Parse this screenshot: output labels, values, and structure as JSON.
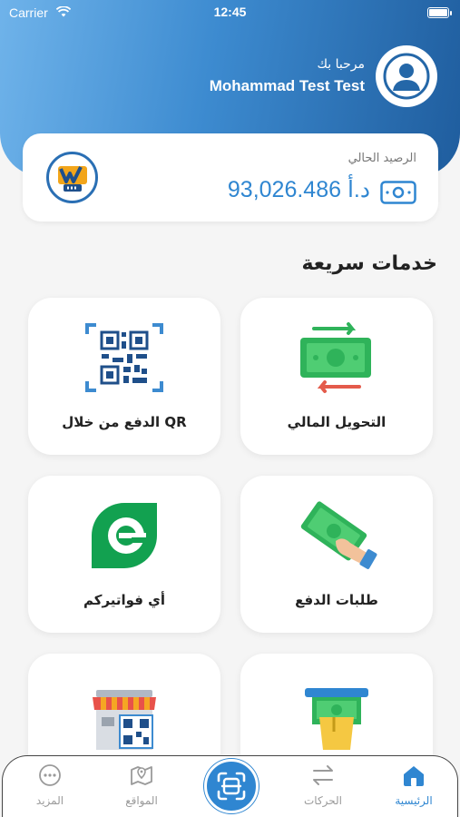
{
  "status_bar": {
    "carrier": "Carrier",
    "time": "12:45"
  },
  "header": {
    "greeting": "مرحبا بك",
    "username": "Mohammad Test Test"
  },
  "balance": {
    "label": "الرصيد الحالي",
    "value": "93,026.486 د.أ"
  },
  "quick_services": {
    "title": "خدمات سريعة",
    "tiles": [
      {
        "label": "التحويل المالي",
        "icon": "money-transfer-icon"
      },
      {
        "label": "الدفع من خلال QR",
        "icon": "qr-code-icon"
      },
      {
        "label": "طلبات الدفع",
        "icon": "hand-cash-icon"
      },
      {
        "label": "أي فواتيركم",
        "icon": "efawateercom-icon"
      },
      {
        "label": "",
        "icon": "atm-withdraw-icon"
      },
      {
        "label": "",
        "icon": "store-qr-icon"
      }
    ]
  },
  "bottom_nav": {
    "items": [
      {
        "label": "الرئيسية",
        "icon": "home-icon",
        "active": true
      },
      {
        "label": "الحركات",
        "icon": "transactions-icon",
        "active": false
      },
      {
        "label": "المواقع",
        "icon": "map-icon",
        "active": false
      },
      {
        "label": "المزيد",
        "icon": "more-icon",
        "active": false
      }
    ],
    "center_icon": "scan-icon"
  },
  "colors": {
    "accent": "#2f86d1",
    "header_dark": "#1f5d9e",
    "header_light": "#6fb3ea",
    "money_green": "#2fb35a"
  }
}
